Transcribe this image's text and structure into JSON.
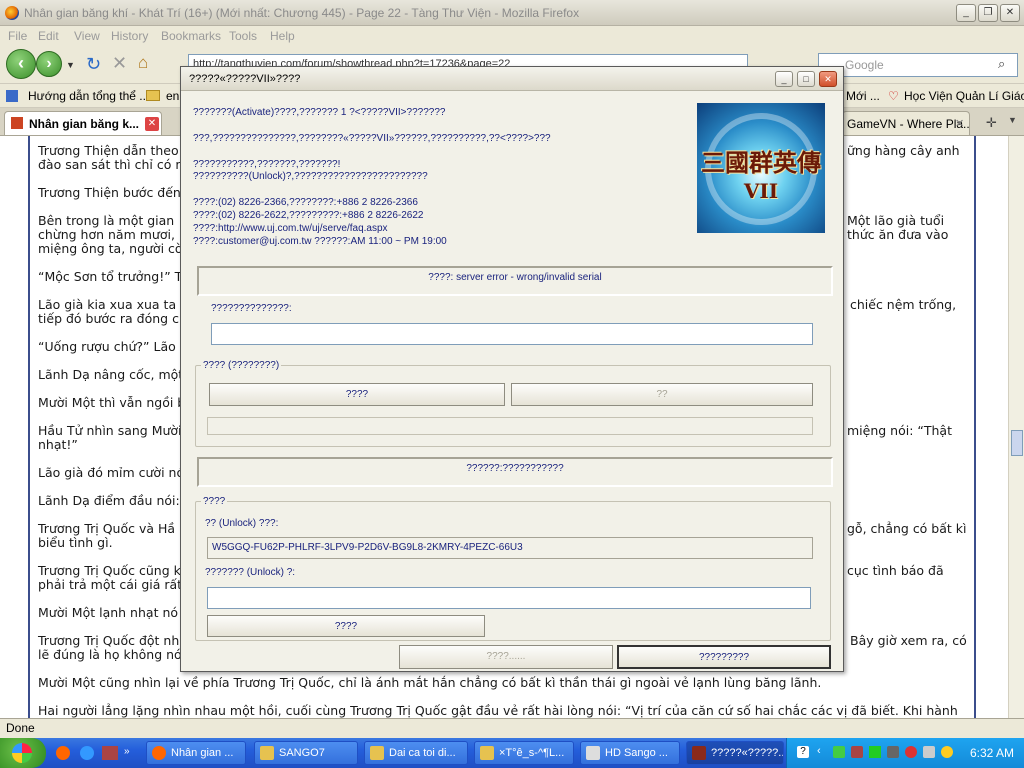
{
  "firefox": {
    "title": "Nhân gian băng khí - Khát Trí (16+) (Mới nhất: Chương 445) - Page 22 - Tàng Thư Viện - Mozilla Firefox",
    "menu": [
      "File",
      "Edit",
      "View",
      "History",
      "Bookmarks",
      "Tools",
      "Help"
    ],
    "url": "http://tangthuvien.com/forum/showthread.php?t=17236&page=22",
    "search_placeholder": "Google",
    "bookmarks": [
      "Hướng dẫn tổng thể ...",
      "en",
      "Mới ...",
      "Học Viện Quản Lí Giáo ..."
    ],
    "tabs": [
      "Nhân gian băng k...",
      "GameVN - Where Pla..."
    ],
    "status": "Done"
  },
  "article": {
    "paragraphs": [
      "Trương Thiện dẫn theo",
      "đào san sát thì chỉ có n",
      "Trương Thiện bước đến",
      "Bên trong là một gian",
      "chừng hơn năm mươi, l",
      "miệng ông ta, người cò",
      "“Mộc Sơn tổ trưởng!” T",
      "Lão già kia xua xua ta",
      "tiếp đó bước ra đóng c",
      "“Uống rượu chứ?” Lão",
      "Lãnh Dạ nâng cốc, một",
      "Mười Một thì vẫn ngồi b",
      "Hầu Tử nhìn sang Mười",
      "nhạt!”",
      "Lão già đó mỉm cười nó",
      "Lãnh Dạ điểm đầu nói:",
      "Trương Trị Quốc và Hầ",
      "biểu tình gì.",
      "Trương Trị Quốc cũng k",
      "phải trả một cái giá rất",
      "Mười Một lạnh nhạt nó",
      "Trương Trị Quốc đột nh",
      "lẽ đúng là họ không nó",
      "Mười Một cũng nhìn lại về phía Trương Trị Quốc, chỉ là ánh mắt hắn chẳng có bất kì thần thái gì ngoài vẻ lạnh lùng băng lãnh.",
      "Hai người lẳng lặng nhìn nhau một hồi, cuối cùng Trương Trị Quốc gật đầu vẻ rất hài lòng nói: “Vị trí của căn cứ số hai chắc các vị đã biết. Khi hành"
    ],
    "right_fragments": [
      "ững hàng cây anh",
      "Một lão già tuổi",
      "thức ăn đưa vào",
      "chiếc nệm trống,",
      "miệng nói: “Thật",
      "gỗ, chẳng có bất kì",
      "cục tình báo đã",
      "Bây giờ xem ra, có"
    ]
  },
  "dialog": {
    "title": "?????«?????VII»????",
    "info_lines": [
      "???????(Activate)????,??????? 1 ?<?????VII>???????",
      "???,???????????????,????????«?????VII»??????,??????????,??<????>???",
      "???????????,???????,???????!",
      "??????????(Unlock)?,????????????????????????",
      "????:(02) 8226-2366,????????:+886 2 8226-2366",
      "????:(02) 8226-2622,?????????:+886 2 8226-2622",
      "????:http://www.uj.com.tw/uj/serve/faq.aspx",
      "????:customer@uj.com.tw ??????:AM 11:00 ~ PM 19:00"
    ],
    "logo_text": "三國群英傳",
    "logo_sub": "VII",
    "status_text": "????: server error - wrong/invalid serial",
    "serial_label": "??????????????:",
    "serial_value": "",
    "group1_label": "???? (????????)",
    "btn_online": "????",
    "btn_cancel": "??",
    "bar2_text": "??????:???????????",
    "group2_label": "????",
    "unlock_code_label": "?? (Unlock) ???:",
    "unlock_code": "W5GGQ-FU62P-PHLRF-3LPV9-P2D6V-BG9L8-2KMRY-4PEZC-66U3",
    "unlock_input_label": "??????? (Unlock) ?:",
    "unlock_input_value": "",
    "btn_unlock": "????",
    "btn_bottom_left": "????......",
    "btn_bottom_right": "?????????"
  },
  "taskbar": {
    "tasks": [
      "Nhân gian ...",
      "SANGO7",
      "Dai ca toi di...",
      "×T°ê_s-^¶L...",
      "HD Sango ...",
      "?????«?????..."
    ],
    "clock": "6:32 AM"
  }
}
